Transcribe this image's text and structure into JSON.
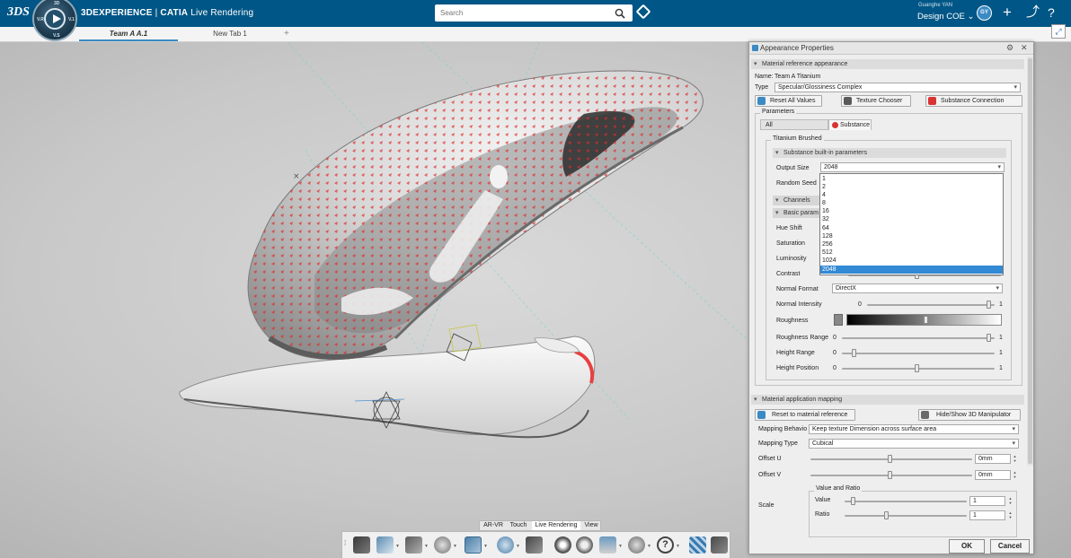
{
  "app": {
    "brand_logo": "3DS",
    "brand": "3DEXPERIENCE",
    "product": "CATIA",
    "module": "Live Rendering",
    "compass_labels": [
      "3D",
      "V.R",
      "V.1",
      "V.S"
    ]
  },
  "header": {
    "search_placeholder": "Search",
    "user_name": "Guanghe YAN",
    "app_selector": "Design COE",
    "avatar_initials": "GY",
    "accent_color": "#005686"
  },
  "tabs": [
    {
      "label": "Team A A.1",
      "active": true
    },
    {
      "label": "New Tab 1",
      "active": false
    }
  ],
  "panel": {
    "title": "Appearance Properties",
    "sections": {
      "material_reference": "Material reference appearance",
      "material_mapping": "Material application mapping"
    },
    "name_label": "Name:",
    "name_value": "Team A Titanium",
    "type_label": "Type",
    "type_value": "Specular/Glossiness Complex",
    "buttons": {
      "reset_all": "Reset All Values",
      "texture_chooser": "Texture Chooser",
      "substance_connection": "Substance Connection",
      "reset_to_material": "Reset to material reference",
      "hide_show_manipulator": "Hide/Show 3D Manipulator",
      "ok": "OK",
      "cancel": "Cancel"
    },
    "parameters_label": "Parameters",
    "param_tabs": [
      "All",
      "Substance"
    ],
    "substance_group": "Titanium Brushed",
    "builtin_label": "Substance built-in parameters",
    "output_size_label": "Output Size",
    "output_size_value": "2048",
    "random_seed_label": "Random Seed",
    "channels_label": "Channels",
    "basic_params_label": "Basic param",
    "dropdown_options": [
      "1",
      "2",
      "4",
      "8",
      "16",
      "32",
      "64",
      "128",
      "256",
      "512",
      "1024",
      "2048"
    ],
    "dropdown_selected": "2048",
    "sliders": [
      {
        "label": "Hue Shift"
      },
      {
        "label": "Saturation"
      },
      {
        "label": "Luminosity"
      },
      {
        "label": "Contrast",
        "value_fraction": 0.56
      }
    ],
    "normal_format_label": "Normal Format",
    "normal_format_value": "DirectX",
    "normal_intensity": {
      "label": "Normal Intensity",
      "min": "0",
      "max": "1",
      "value_fraction": 1.0
    },
    "roughness": {
      "label": "Roughness",
      "value_fraction": 0.5
    },
    "roughness_range": {
      "label": "Roughness Range",
      "min": "0",
      "max": "1",
      "value_fraction": 1.0
    },
    "height_range": {
      "label": "Height Range",
      "min": "0",
      "max": "1",
      "value_fraction": 0.05
    },
    "height_position": {
      "label": "Height Position",
      "min": "0",
      "max": "1",
      "value_fraction": 0.5
    },
    "mapping_behavior_label": "Mapping Behavio",
    "mapping_behavior_value": "Keep texture Dimension across surface area",
    "mapping_type_label": "Mapping Type",
    "mapping_type_value": "Cubical",
    "offset_u": {
      "label": "Offset U",
      "value": "0mm",
      "value_fraction": 0.5
    },
    "offset_v": {
      "label": "Offset V",
      "value": "0mm",
      "value_fraction": 0.5
    },
    "scale_label": "Scale",
    "value_ratio_label": "Value and Ratio",
    "scale_value": {
      "label": "Value",
      "value": "1",
      "value_fraction": 0.05
    },
    "scale_ratio": {
      "label": "Ratio",
      "value": "1",
      "value_fraction": 0.3
    }
  },
  "bottom_tabs": [
    {
      "label": "AR-VR",
      "active": false
    },
    {
      "label": "Touch",
      "active": false
    },
    {
      "label": "Live Rendering",
      "active": true
    },
    {
      "label": "View",
      "active": false
    }
  ],
  "toolbar_icons": [
    "clapper-icon",
    "render-image-icon",
    "environment-icon",
    "materials-icon",
    "appearance-icon",
    "add-camera-icon",
    "camera-icon",
    "render-settings-icon",
    "settings-gear-icon",
    "stack-icon",
    "tools-icon",
    "help-icon",
    "checker-icon",
    "tree-icon"
  ]
}
